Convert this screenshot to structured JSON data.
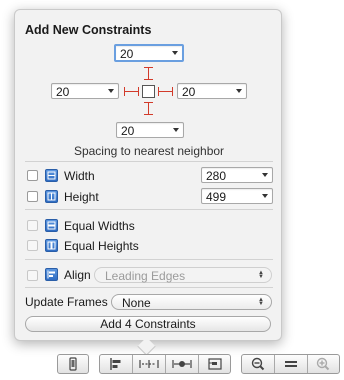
{
  "popover": {
    "title": "Add New Constraints",
    "spacing": {
      "top": "20",
      "left": "20",
      "right": "20",
      "bottom": "20",
      "caption": "Spacing to nearest neighbor"
    },
    "width": {
      "label": "Width",
      "value": "280",
      "checked": false
    },
    "height": {
      "label": "Height",
      "value": "499",
      "checked": false
    },
    "equal_widths": {
      "label": "Equal Widths",
      "enabled": false
    },
    "equal_heights": {
      "label": "Equal Heights",
      "enabled": false
    },
    "align": {
      "label": "Align",
      "value": "Leading Edges",
      "enabled": false
    },
    "update_frames": {
      "label": "Update Frames",
      "value": "None"
    },
    "add_button": "Add 4 Constraints"
  },
  "toolbar": {
    "icons": [
      "device-icon",
      "align-icon",
      "pin-icon",
      "resolve-icon",
      "resizing-icon",
      "zoom-out-icon",
      "zoom-reset-icon",
      "zoom-in-icon"
    ]
  },
  "colors": {
    "constraint_red": "#d23a2a",
    "icon_blue": "#3a78cf",
    "focus_ring": "#6a9fe0"
  }
}
